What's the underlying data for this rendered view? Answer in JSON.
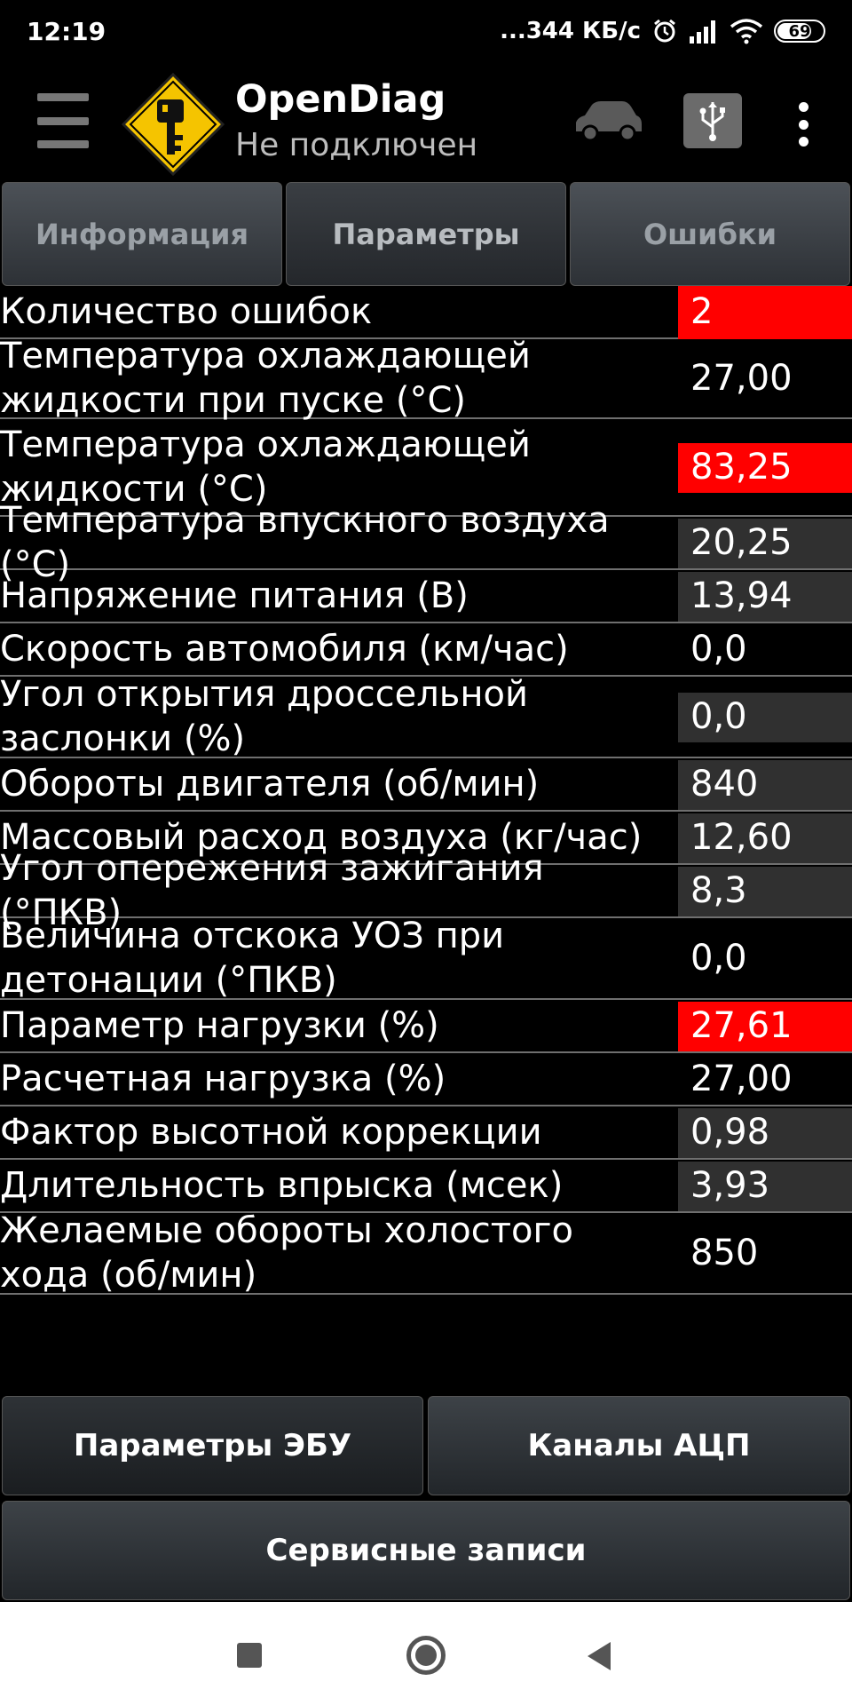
{
  "status_bar": {
    "time": "12:19",
    "network_speed": "...344 КБ/с",
    "battery": "69",
    "battery_level": 0.69
  },
  "header": {
    "title": "OpenDiag",
    "subtitle": "Не подключен"
  },
  "tabs": [
    {
      "label": "Информация",
      "active": false
    },
    {
      "label": "Параметры",
      "active": true
    },
    {
      "label": "Ошибки",
      "active": false
    }
  ],
  "colors": {
    "alert_red": "#ff0000",
    "value_bg_dark": "#303030",
    "row_divider": "#6f6f6f"
  },
  "parameters": [
    {
      "label": "Количество ошибок",
      "value": "2",
      "highlight": "red"
    },
    {
      "label": "Температура охлаждающей жидкости при пуске (°C)",
      "value": "27,00",
      "highlight": "none"
    },
    {
      "label": "Температура охлаждающей жидкости (°C)",
      "value": "83,25",
      "highlight": "red"
    },
    {
      "label": "Температура впускного воздуха (°C)",
      "value": "20,25",
      "highlight": "dark"
    },
    {
      "label": "Напряжение питания (В)",
      "value": "13,94",
      "highlight": "dark"
    },
    {
      "label": "Скорость автомобиля (км/час)",
      "value": "0,0",
      "highlight": "none"
    },
    {
      "label": "Угол открытия дроссельной заслонки (%)",
      "value": "0,0",
      "highlight": "dark"
    },
    {
      "label": "Обороты двигателя (об/мин)",
      "value": "840",
      "highlight": "dark"
    },
    {
      "label": "Массовый расход воздуха (кг/час)",
      "value": "12,60",
      "highlight": "dark"
    },
    {
      "label": "Угол опережения зажигания (°ПКВ)",
      "value": "8,3",
      "highlight": "dark"
    },
    {
      "label": "Величина отскока УОЗ при детонации (°ПКВ)",
      "value": "0,0",
      "highlight": "none"
    },
    {
      "label": "Параметр нагрузки (%)",
      "value": "27,61",
      "highlight": "red"
    },
    {
      "label": "Расчетная нагрузка (%)",
      "value": "27,00",
      "highlight": "none"
    },
    {
      "label": "Фактор высотной коррекции",
      "value": "0,98",
      "highlight": "dark"
    },
    {
      "label": "Длительность впрыска (мсек)",
      "value": "3,93",
      "highlight": "dark"
    },
    {
      "label": "Желаемые обороты холостого хода (об/мин)",
      "value": "850",
      "highlight": "none"
    }
  ],
  "bottom_buttons": {
    "ecu_params": "Параметры ЭБУ",
    "adc_channels": "Каналы АЦП",
    "service_records": "Сервисные записи"
  },
  "icons": {
    "menu": "hamburger-menu-icon",
    "logo": "key-diamond-logo-icon",
    "car": "car-icon",
    "usb": "usb-icon",
    "more": "more-vert-icon",
    "alarm": "alarm-clock-icon",
    "signal": "signal-bars-icon",
    "wifi": "wifi-icon"
  }
}
